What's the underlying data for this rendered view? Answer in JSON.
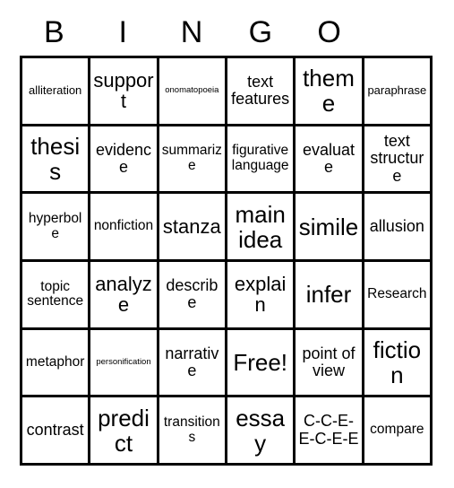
{
  "card": {
    "title": "BINGO",
    "header_letters": [
      "B",
      "I",
      "N",
      "G",
      "O"
    ],
    "columns": 6,
    "rows": 6,
    "free_space_label": "Free!",
    "colors": {
      "grid_line": "#000000",
      "background": "#ffffff",
      "text": "#000000"
    },
    "cells": [
      {
        "text": "alliteration",
        "size": "sm"
      },
      {
        "text": "support",
        "size": "xl"
      },
      {
        "text": "onomatopoeia",
        "size": "xs"
      },
      {
        "text": "text features",
        "size": "lg"
      },
      {
        "text": "theme",
        "size": "xxl"
      },
      {
        "text": "paraphrase",
        "size": "sm"
      },
      {
        "text": "thesis",
        "size": "xxl"
      },
      {
        "text": "evidence",
        "size": "lg"
      },
      {
        "text": "summarize",
        "size": "md"
      },
      {
        "text": "figurative language",
        "size": "md"
      },
      {
        "text": "evaluate",
        "size": "lg"
      },
      {
        "text": "text structure",
        "size": "lg"
      },
      {
        "text": "hyperbole",
        "size": "md"
      },
      {
        "text": "nonfiction",
        "size": "md"
      },
      {
        "text": "stanza",
        "size": "xl"
      },
      {
        "text": "main idea",
        "size": "xxl"
      },
      {
        "text": "simile",
        "size": "xxl"
      },
      {
        "text": "allusion",
        "size": "lg"
      },
      {
        "text": "topic sentence",
        "size": "md"
      },
      {
        "text": "analyze",
        "size": "xl"
      },
      {
        "text": "describe",
        "size": "lg"
      },
      {
        "text": "explain",
        "size": "xl"
      },
      {
        "text": "infer",
        "size": "xxl"
      },
      {
        "text": "Research",
        "size": "md"
      },
      {
        "text": "metaphor",
        "size": "md"
      },
      {
        "text": "personification",
        "size": "xs"
      },
      {
        "text": "narrative",
        "size": "lg"
      },
      {
        "text": "Free!",
        "size": "xxl"
      },
      {
        "text": "point of view",
        "size": "lg"
      },
      {
        "text": "fiction",
        "size": "xxl"
      },
      {
        "text": "contrast",
        "size": "lg"
      },
      {
        "text": "predict",
        "size": "xxl"
      },
      {
        "text": "transitions",
        "size": "md"
      },
      {
        "text": "essay",
        "size": "xxl"
      },
      {
        "text": "C-C-E-E-C-E-E",
        "size": "lg"
      },
      {
        "text": "compare",
        "size": "md"
      }
    ]
  }
}
